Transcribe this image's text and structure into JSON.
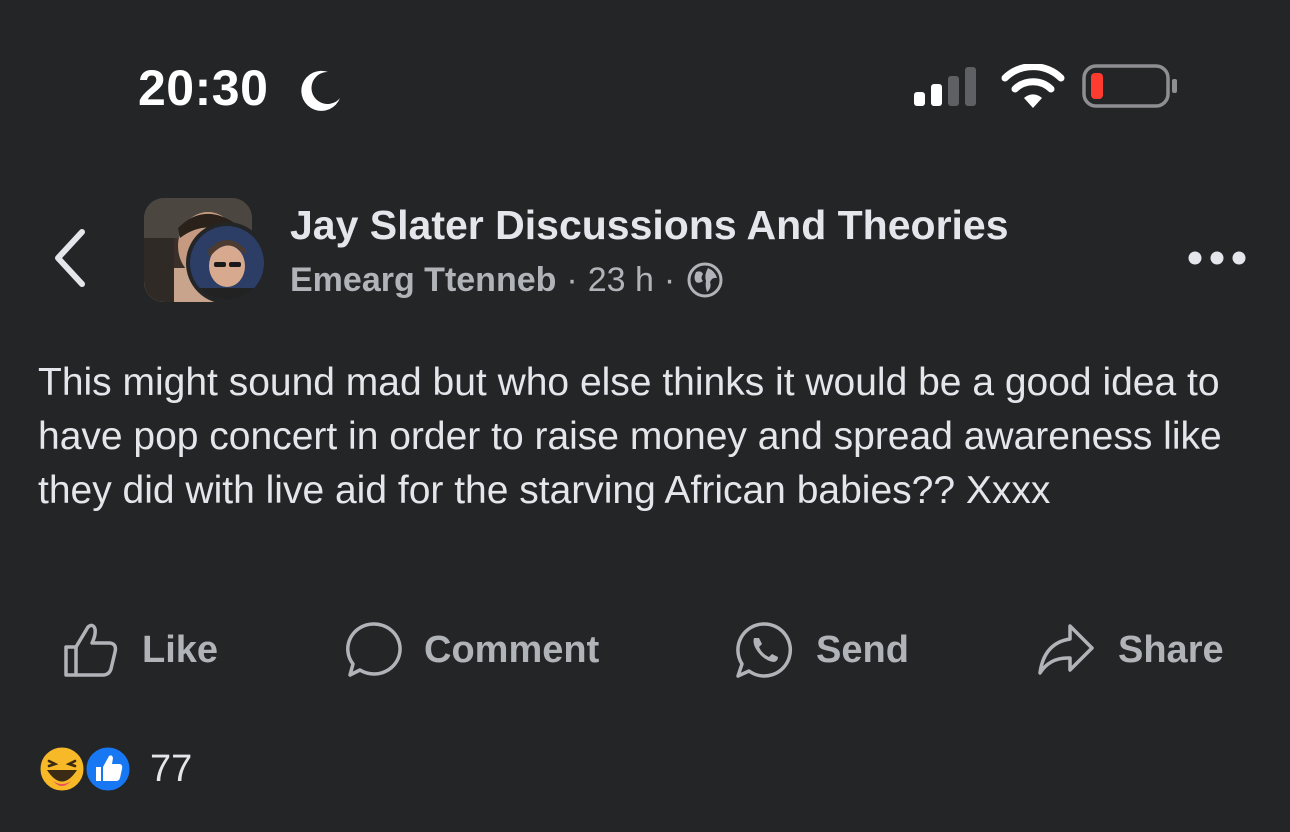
{
  "status_bar": {
    "time": "20:30",
    "moon_icon": "moon-icon",
    "signal_icon": "cellular-signal-icon",
    "wifi_icon": "wifi-icon",
    "battery_icon": "battery-low-icon",
    "battery_color": "#ff3b30"
  },
  "header": {
    "back_icon": "chevron-left-icon",
    "group_name": "Jay Slater Discussions And Theories",
    "author": "Emearg Ttenneb",
    "separator": "·",
    "time_ago": "23 h",
    "privacy_icon": "globe-icon",
    "more_icon": "more-horizontal-icon"
  },
  "post": {
    "text": "This might sound mad but who else thinks it would be a good idea to have pop concert in order to raise money and spread awareness like they did with live aid for the starving African babies?? Xxxx"
  },
  "actions": {
    "like": "Like",
    "comment": "Comment",
    "send": "Send",
    "share": "Share"
  },
  "reactions": {
    "icons": [
      "haha-emoji-icon",
      "like-thumb-icon"
    ],
    "count": "77",
    "like_color": "#1877f2",
    "haha_color": "#f7b928"
  }
}
